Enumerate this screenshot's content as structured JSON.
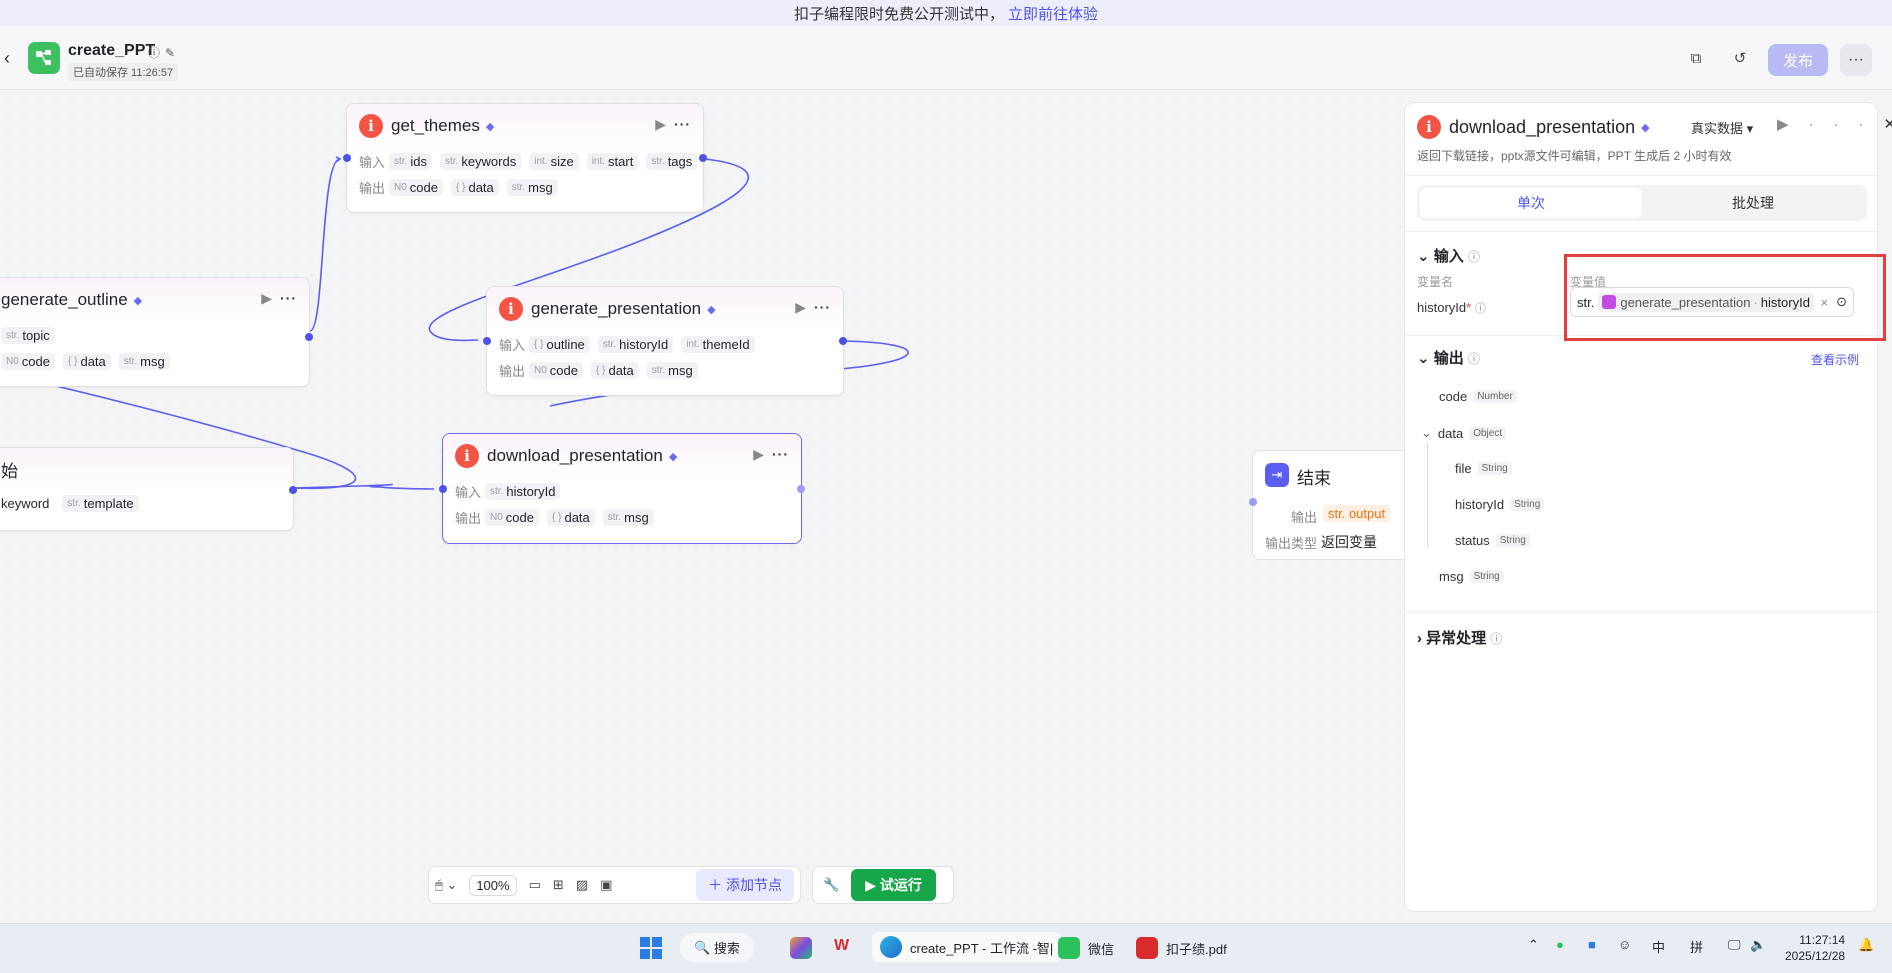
{
  "banner": {
    "text": "扣子编程限时免费公开测试中，",
    "link": "立即前往体验"
  },
  "header": {
    "title": "create_PPT",
    "saved": "已自动保存 11:26:57",
    "publish": "发布"
  },
  "nodes": {
    "get_themes": {
      "title": "get_themes",
      "in_label": "输入",
      "out_label": "输出",
      "inputs": [
        {
          "t": "str.",
          "n": "ids"
        },
        {
          "t": "str.",
          "n": "keywords"
        },
        {
          "t": "int.",
          "n": "size"
        },
        {
          "t": "int.",
          "n": "start"
        },
        {
          "t": "str.",
          "n": "tags"
        }
      ],
      "outputs": [
        {
          "t": "N0",
          "n": "code"
        },
        {
          "t": "{ }",
          "n": "data"
        },
        {
          "t": "str.",
          "n": "msg"
        }
      ]
    },
    "generate_outline": {
      "title": "generate_outline",
      "inputs": [
        {
          "t": "str.",
          "n": "topic"
        }
      ],
      "outputs": [
        {
          "t": "N0",
          "n": "code"
        },
        {
          "t": "{ }",
          "n": "data"
        },
        {
          "t": "str.",
          "n": "msg"
        }
      ]
    },
    "generate_presentation": {
      "title": "generate_presentation",
      "in_label": "输入",
      "out_label": "输出",
      "inputs": [
        {
          "t": "{ }",
          "n": "outline"
        },
        {
          "t": "str.",
          "n": "historyId"
        },
        {
          "t": "int.",
          "n": "themeId"
        }
      ],
      "outputs": [
        {
          "t": "N0",
          "n": "code"
        },
        {
          "t": "{ }",
          "n": "data"
        },
        {
          "t": "str.",
          "n": "msg"
        }
      ]
    },
    "start": {
      "title": "始",
      "inputs": [
        {
          "t": "",
          "n": "keyword"
        },
        {
          "t": "str.",
          "n": "template"
        }
      ]
    },
    "download_presentation": {
      "title": "download_presentation",
      "in_label": "输入",
      "out_label": "输出",
      "inputs": [
        {
          "t": "str.",
          "n": "historyId"
        }
      ],
      "outputs": [
        {
          "t": "N0",
          "n": "code"
        },
        {
          "t": "{ }",
          "n": "data"
        },
        {
          "t": "str.",
          "n": "msg"
        }
      ]
    },
    "end": {
      "title": "结束",
      "out_label": "输出",
      "output_tag": "str. output",
      "type_label": "输出类型",
      "type_value": "返回变量"
    }
  },
  "toolbar": {
    "zoom": "100%",
    "add_node": "添加节点",
    "run": "试运行"
  },
  "panel": {
    "title": "download_presentation",
    "desc": "返回下载链接，pptx源文件可编辑，PPT 生成后 2 小时有效",
    "real_data": "真实数据",
    "tabs": [
      "单次",
      "批处理"
    ],
    "input_section": "输入",
    "var_name_label": "变量名",
    "var_value_label": "变量值",
    "var_name": "historyId",
    "var_type": "str.",
    "ref_node": "generate_presentation",
    "ref_field": "historyId",
    "output_section": "输出",
    "view_example": "查看示例",
    "outputs": [
      {
        "name": "code",
        "type": "Number"
      },
      {
        "name": "data",
        "type": "Object"
      },
      {
        "name": "file",
        "type": "String"
      },
      {
        "name": "historyId",
        "type": "String"
      },
      {
        "name": "status",
        "type": "String"
      },
      {
        "name": "msg",
        "type": "String"
      }
    ],
    "error_section": "异常处理"
  },
  "taskbar": {
    "search": "搜索",
    "browser_tab": "create_PPT - 工作流 -智|",
    "wechat": "微信",
    "pdf": "扣子绩.pdf",
    "ime1": "中",
    "ime2": "拼",
    "time": "11:27:14",
    "date": "2025/12/28"
  }
}
